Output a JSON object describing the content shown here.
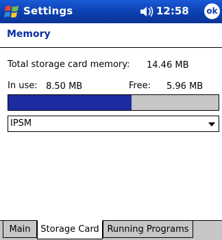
{
  "titlebar": {
    "app_title": "Settings",
    "time": "12:58",
    "ok_label": "ok",
    "start_icon": "windows-flag-icon",
    "volume_icon": "speaker-icon"
  },
  "page": {
    "title": "Memory"
  },
  "storage": {
    "total_label": "Total storage card memory:",
    "total_value": "14.46 MB",
    "in_use_label": "In use:",
    "in_use_value": "8.50 MB",
    "free_label": "Free:",
    "free_value": "5.96 MB",
    "usage_fraction": 0.5878
  },
  "card_select": {
    "value": "IPSM"
  },
  "tabs": [
    {
      "label": "Main",
      "active": false
    },
    {
      "label": "Storage Card",
      "active": true
    },
    {
      "label": "Running Programs",
      "active": false
    }
  ],
  "colors": {
    "titlebar": "#0b3fb0",
    "title_text": "#0a2fa3",
    "progress_fill": "#1c2ca0",
    "progress_track": "#c6c6c6"
  }
}
